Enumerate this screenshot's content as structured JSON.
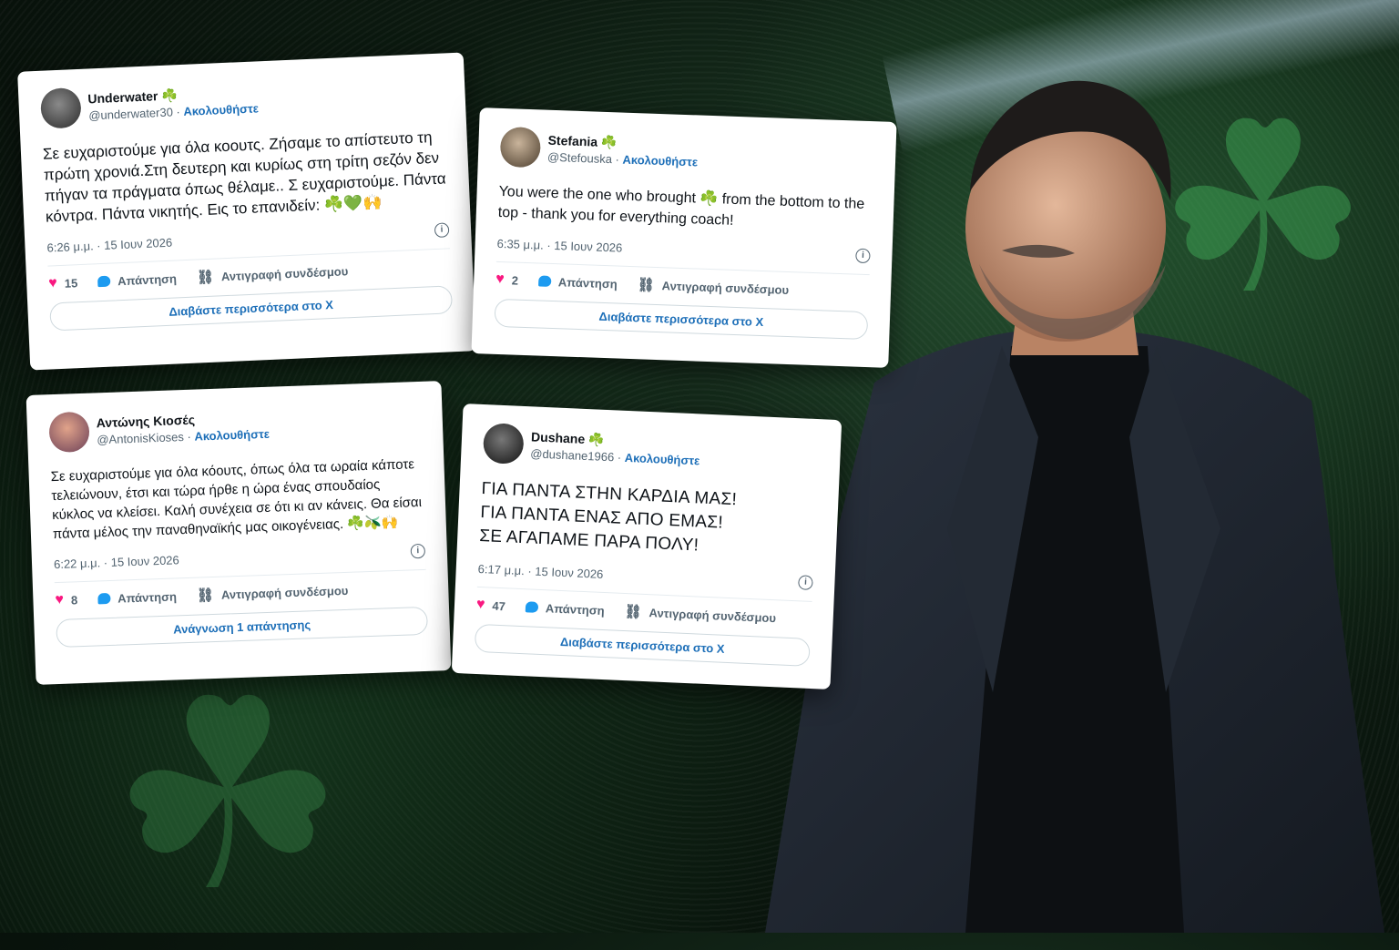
{
  "tweets": [
    {
      "name": "Underwater",
      "name_emoji": "☘️",
      "handle": "@underwater30",
      "follow": "Ακολουθήστε",
      "text": "Σε ευχαριστούμε για όλα κοουτς. Ζήσαμε το απίστευτο τη πρώτη χρονιά.Στη δευτερη και κυρίως στη τρίτη σεζόν δεν πήγαν τα πράγματα όπως θέλαμε.. Σ ευχαριστούμε. Πάντα κόντρα. Πάντα νικητής. Εις το επανιδείν: ☘️💚🙌",
      "time": "6:26 μ.μ. · 15 Ιουν 2026",
      "likes": "15",
      "reply": "Απάντηση",
      "copy_link": "Αντιγραφή συνδέσμου",
      "cta": "Διαβάστε περισσότερα στο X"
    },
    {
      "name": "Stefania",
      "name_emoji": "☘️",
      "handle": "@Stefouska",
      "follow": "Ακολουθήστε",
      "text": "You were the one who brought ☘️ from the bottom to the top - thank you for everything coach!",
      "time": "6:35 μ.μ. · 15 Ιουν 2026",
      "likes": "2",
      "reply": "Απάντηση",
      "copy_link": "Αντιγραφή συνδέσμου",
      "cta": "Διαβάστε περισσότερα στο X"
    },
    {
      "name": "Αντώνης Κιοσές",
      "name_emoji": "",
      "handle": "@AntonisKioses",
      "follow": "Ακολουθήστε",
      "text": "Σε ευχαριστούμε για όλα κόουτς, όπως όλα τα ωραία κάποτε τελειώνουν, έτσι και τώρα ήρθε η ώρα ένας σπουδαίος κύκλος να κλείσει. Καλή συνέχεια σε ότι κι αν κάνεις. Θα είσαι πάντα μέλος την παναθηναϊκής μας οικογένειας. ☘️🫒🙌",
      "time": "6:22 μ.μ. · 15 Ιουν 2026",
      "likes": "8",
      "reply": "Απάντηση",
      "copy_link": "Αντιγραφή συνδέσμου",
      "cta": "Ανάγνωση 1 απάντησης"
    },
    {
      "name": "Dushane",
      "name_emoji": "☘️",
      "handle": "@dushane1966",
      "follow": "Ακολουθήστε",
      "text": "ΓΙΑ ΠΑΝΤΑ ΣΤΗΝ ΚΑΡΔΙΑ ΜΑΣ!\nΓΙΑ ΠΑΝΤΑ ΕΝΑΣ ΑΠΟ ΕΜΑΣ!\nΣΕ ΑΓΑΠΑΜΕ ΠΑΡΑ ΠΟΛΥ!",
      "time": "6:17 μ.μ. · 15 Ιουν 2026",
      "likes": "47",
      "reply": "Απάντηση",
      "copy_link": "Αντιγραφή συνδέσμου",
      "cta": "Διαβάστε περισσότερα στο X"
    }
  ],
  "icons": {
    "like": "heart-icon",
    "reply": "reply-icon",
    "copy": "link-icon",
    "info": "info-icon",
    "decor": "shamrock-icon"
  },
  "colors": {
    "accent_green": "#3a9b4a",
    "link_blue": "#1d6fb8",
    "like_pink": "#f91880"
  }
}
